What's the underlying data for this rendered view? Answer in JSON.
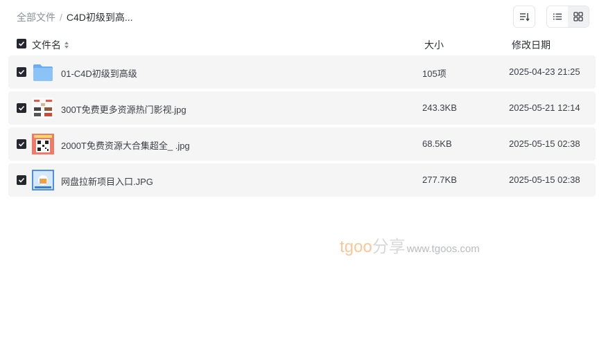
{
  "breadcrumb": {
    "root": "全部文件",
    "separator": "/",
    "current": "C4D初级到高..."
  },
  "toolbar": {
    "sort_icon": "sort-icon",
    "list_icon": "list-view-icon",
    "grid_icon": "grid-view-icon"
  },
  "table": {
    "headers": {
      "name": "文件名",
      "size": "大小",
      "date": "修改日期"
    },
    "rows": [
      {
        "name": "01-C4D初级到高级",
        "size": "105项",
        "date": "2025-04-23 21:25",
        "kind": "folder"
      },
      {
        "name": "300T免费更多资源热门影视.jpg",
        "size": "243.3KB",
        "date": "2025-05-21 12:14",
        "kind": "image"
      },
      {
        "name": "2000T免费资源大合集超全_ .jpg",
        "size": "68.5KB",
        "date": "2025-05-15 02:38",
        "kind": "image"
      },
      {
        "name": "网盘拉新项目入口.JPG",
        "size": "277.7KB",
        "date": "2025-05-15 02:38",
        "kind": "image"
      }
    ]
  },
  "watermark": {
    "brand": "tgoo",
    "cn": "分享",
    "url": "www.tgoos.com"
  },
  "colors": {
    "row_bg": "#f5f5f6",
    "checkbox": "#24272d",
    "folder": "#7ab8f5",
    "brand": "#f6c89a"
  }
}
